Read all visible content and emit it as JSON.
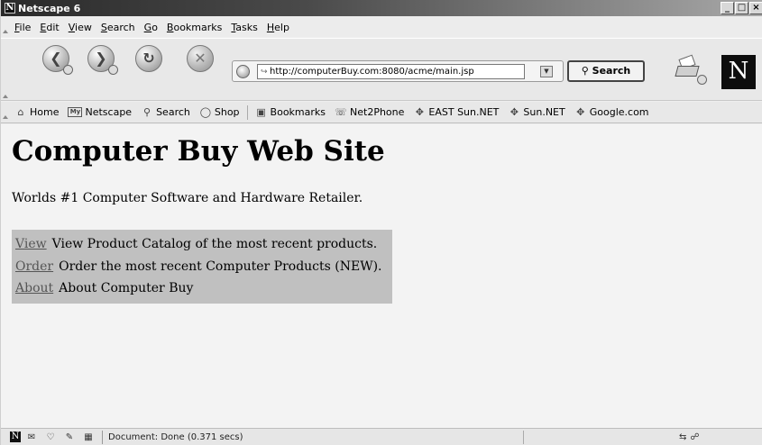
{
  "window": {
    "title": "Netscape 6",
    "app_icon": "N",
    "controls": {
      "minimize": "_",
      "maximize": "□",
      "close": "×"
    }
  },
  "menubar": {
    "items": [
      {
        "accel": "F",
        "rest": "ile"
      },
      {
        "accel": "E",
        "rest": "dit"
      },
      {
        "accel": "V",
        "rest": "iew"
      },
      {
        "accel": "S",
        "rest": "earch"
      },
      {
        "accel": "G",
        "rest": "o"
      },
      {
        "accel": "B",
        "rest": "ookmarks"
      },
      {
        "accel": "T",
        "rest": "asks"
      },
      {
        "accel": "H",
        "rest": "elp"
      }
    ]
  },
  "navbar": {
    "back_icon": "back-arrow",
    "forward_icon": "forward-arrow",
    "reload_icon": "reload",
    "stop_icon": "stop",
    "url": "http://computerBuy.com:8080/acme/main.jsp",
    "search_label": "Search",
    "logo": "N"
  },
  "personal_toolbar": {
    "items": [
      {
        "icon": "home-icon",
        "label": "Home"
      },
      {
        "icon": "my-netscape-icon",
        "label": "Netscape"
      },
      {
        "icon": "search-icon",
        "label": "Search"
      },
      {
        "icon": "shop-icon",
        "label": "Shop"
      },
      {
        "icon": "bookmarks-icon",
        "label": "Bookmarks"
      },
      {
        "icon": "net2phone-icon",
        "label": "Net2Phone"
      },
      {
        "icon": "link-icon",
        "label": "EAST Sun.NET"
      },
      {
        "icon": "link-icon",
        "label": "Sun.NET"
      },
      {
        "icon": "link-icon",
        "label": "Google.com"
      }
    ]
  },
  "page": {
    "title": "Computer Buy Web Site",
    "tagline": "Worlds #1 Computer Software and Hardware Retailer.",
    "menu": [
      {
        "link": "View",
        "description": "View Product Catalog of the most recent products."
      },
      {
        "link": "Order",
        "description": "Order the most recent Computer Products (NEW)."
      },
      {
        "link": "About",
        "description": "About Computer Buy"
      }
    ]
  },
  "statusbar": {
    "text": "Document: Done (0.371 secs)"
  }
}
